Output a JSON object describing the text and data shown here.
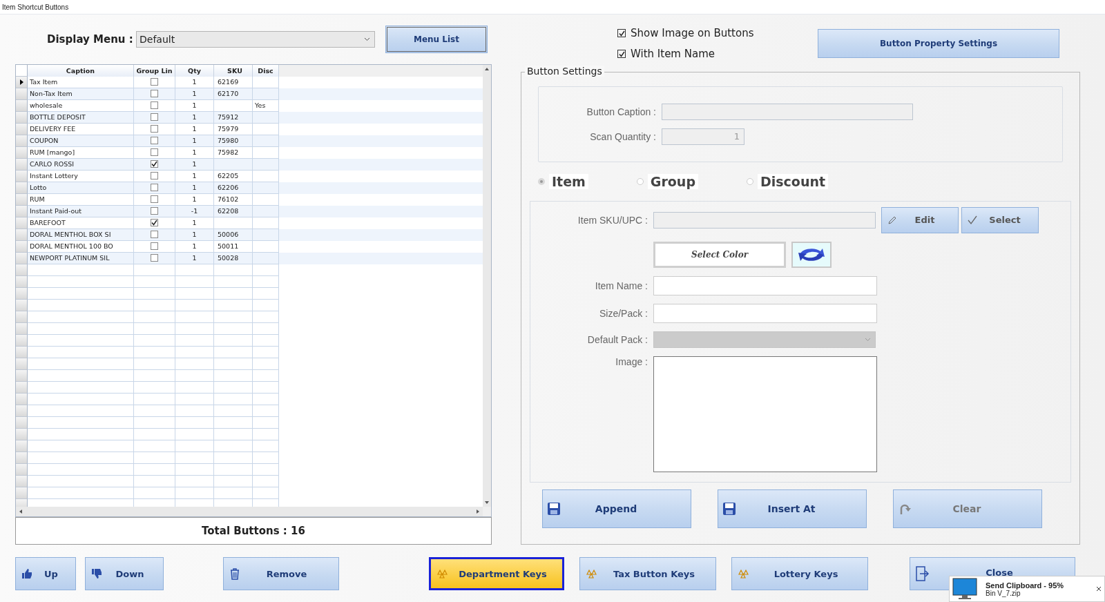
{
  "window": {
    "title": "Item Shortcut Buttons"
  },
  "display_menu": {
    "label": "Display Menu :",
    "value": "Default"
  },
  "menu_list_button": "Menu List",
  "options": [
    {
      "label": "Show Image on Buttons",
      "checked": true
    },
    {
      "label": "With Item Name",
      "checked": true
    }
  ],
  "button_property_settings": "Button Property Settings",
  "grid": {
    "columns": [
      "Caption",
      "Group Lin",
      "Qty",
      "SKU",
      "Disc"
    ],
    "rows": [
      {
        "caption": "Tax Item",
        "group": false,
        "qty": "1",
        "sku": "62169",
        "selected": true
      },
      {
        "caption": "Non-Tax Item",
        "group": false,
        "qty": "1",
        "sku": "62170",
        "selected": false
      },
      {
        "caption": "wholesale",
        "group": false,
        "qty": "1",
        "disc": "Yes",
        "selected": false
      },
      {
        "caption": "BOTTLE DEPOSIT",
        "group": false,
        "qty": "1",
        "sku": "75912",
        "selected": false
      },
      {
        "caption": "DELIVERY FEE",
        "group": false,
        "qty": "1",
        "sku": "75979",
        "selected": false
      },
      {
        "caption": "COUPON",
        "group": false,
        "qty": "1",
        "sku": "75980",
        "selected": false
      },
      {
        "caption": "RUM  [mango]",
        "group": false,
        "qty": "1",
        "sku": "75982",
        "selected": false
      },
      {
        "caption": "CARLO ROSSI",
        "group": true,
        "qty": "1",
        "selected": false
      },
      {
        "caption": "Instant Lottery",
        "group": false,
        "qty": "1",
        "sku": "62205",
        "selected": false
      },
      {
        "caption": "Lotto",
        "group": false,
        "qty": "1",
        "sku": "62206",
        "selected": false
      },
      {
        "caption": "RUM",
        "group": false,
        "qty": "1",
        "sku": "76102",
        "selected": false
      },
      {
        "caption": "Instant Paid-out",
        "group": false,
        "qty": "-1",
        "sku": "62208",
        "selected": false
      },
      {
        "caption": "BAREFOOT",
        "group": true,
        "qty": "1",
        "selected": false
      },
      {
        "caption": "DORAL MENTHOL BOX SI",
        "group": false,
        "qty": "1",
        "sku": "50006",
        "selected": false
      },
      {
        "caption": "DORAL MENTHOL 100 BO",
        "group": false,
        "qty": "1",
        "sku": "50011",
        "selected": false
      },
      {
        "caption": "NEWPORT PLATINUM SIL",
        "group": false,
        "qty": "1",
        "sku": "50028",
        "selected": false
      }
    ]
  },
  "total": "Total Buttons : 16",
  "settings": {
    "title": "Button Settings",
    "caption_label": "Button Caption :",
    "scan_qty_label": "Scan Quantity :",
    "scan_qty": "1",
    "types": [
      {
        "label": "Item",
        "selected": true
      },
      {
        "label": "Group",
        "selected": false
      },
      {
        "label": "Discount",
        "selected": false
      }
    ],
    "sku_label": "Item SKU/UPC :",
    "edit": "Edit",
    "select": "Select",
    "select_color": "Select Color",
    "item_name_label": "Item Name :",
    "size_pack_label": "Size/Pack :",
    "default_pack_label": "Default Pack :",
    "image_label": "Image :",
    "actions": [
      {
        "label": "Append",
        "kind": "save",
        "disabled": false
      },
      {
        "label": "Insert At",
        "kind": "save",
        "disabled": false
      },
      {
        "label": "Clear",
        "kind": "redo",
        "disabled": true
      }
    ]
  },
  "bottom_buttons": [
    {
      "label": "Up",
      "kind": "up",
      "selected": false
    },
    {
      "label": "Down",
      "kind": "down",
      "selected": false
    },
    {
      "label": "Remove",
      "kind": "remove",
      "selected": false
    },
    {
      "label": "Department Keys",
      "kind": "keys",
      "selected": true
    },
    {
      "label": "Tax Button Keys",
      "kind": "keys",
      "selected": false
    },
    {
      "label": "Lottery Keys",
      "kind": "keys",
      "selected": false
    },
    {
      "label": "Close",
      "kind": "exit",
      "selected": false
    }
  ],
  "notification": {
    "title": "Send Clipboard - 95%",
    "file": "Bin V_7.zip"
  }
}
